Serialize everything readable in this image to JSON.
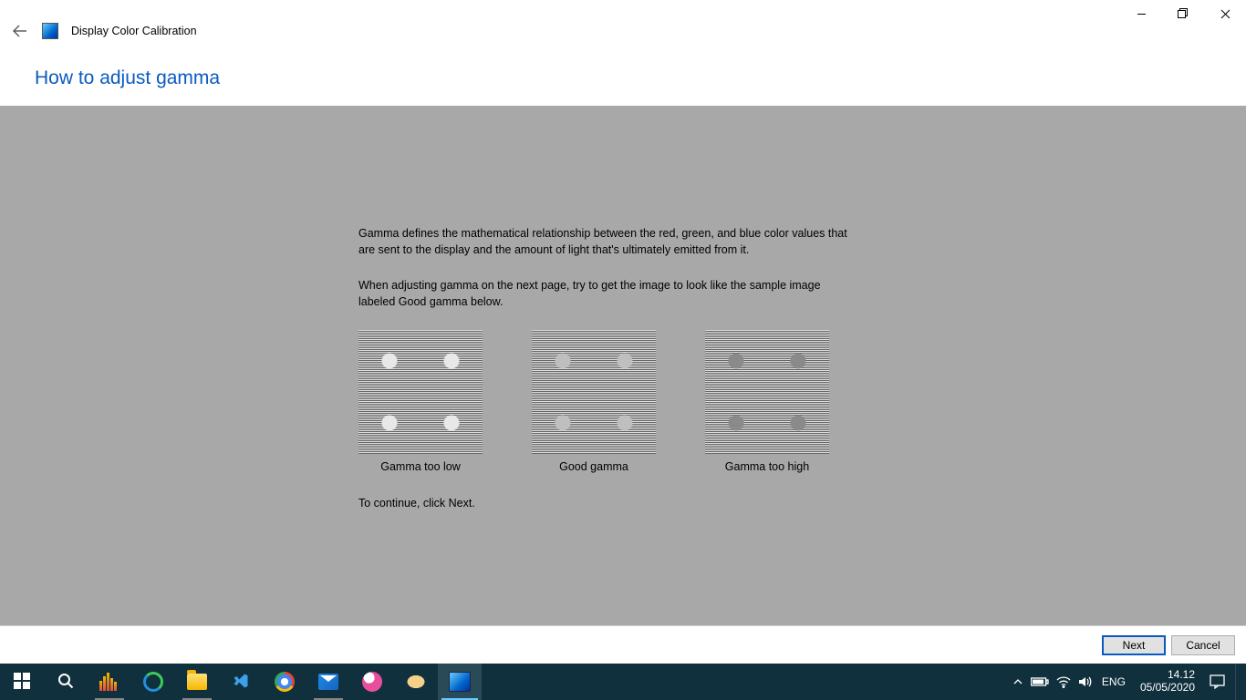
{
  "window": {
    "app_title": "Display Color Calibration",
    "controls": {
      "minimize": "minimize",
      "maximize": "restore",
      "close": "close"
    }
  },
  "page": {
    "heading": "How to adjust gamma",
    "para1": "Gamma defines the mathematical relationship between the red, green, and blue color values that are sent to the display and the amount of light that's ultimately emitted from it.",
    "para2": "When adjusting gamma on the next page, try to get the image to look like the sample image labeled Good gamma below.",
    "samples": [
      {
        "label": "Gamma too low",
        "variant": "low"
      },
      {
        "label": "Good gamma",
        "variant": "good"
      },
      {
        "label": "Gamma too high",
        "variant": "high"
      }
    ],
    "continue_text": "To continue, click Next."
  },
  "wizard_buttons": {
    "next": "Next",
    "cancel": "Cancel"
  },
  "taskbar": {
    "lang": "ENG",
    "time": "14.12",
    "date": "05/05/2020",
    "apps": [
      {
        "name": "start",
        "semantic": "start-icon"
      },
      {
        "name": "search",
        "semantic": "search-icon"
      },
      {
        "name": "wox",
        "semantic": "wox-icon"
      },
      {
        "name": "edge",
        "semantic": "edge-icon"
      },
      {
        "name": "explorer",
        "semantic": "file-explorer-icon"
      },
      {
        "name": "vscode",
        "semantic": "vscode-icon"
      },
      {
        "name": "chrome",
        "semantic": "chrome-icon"
      },
      {
        "name": "mail",
        "semantic": "mail-icon"
      },
      {
        "name": "sketch",
        "semantic": "sketchbook-icon"
      },
      {
        "name": "paint",
        "semantic": "paint-icon"
      },
      {
        "name": "dccw",
        "semantic": "display-calibration-icon"
      }
    ]
  }
}
